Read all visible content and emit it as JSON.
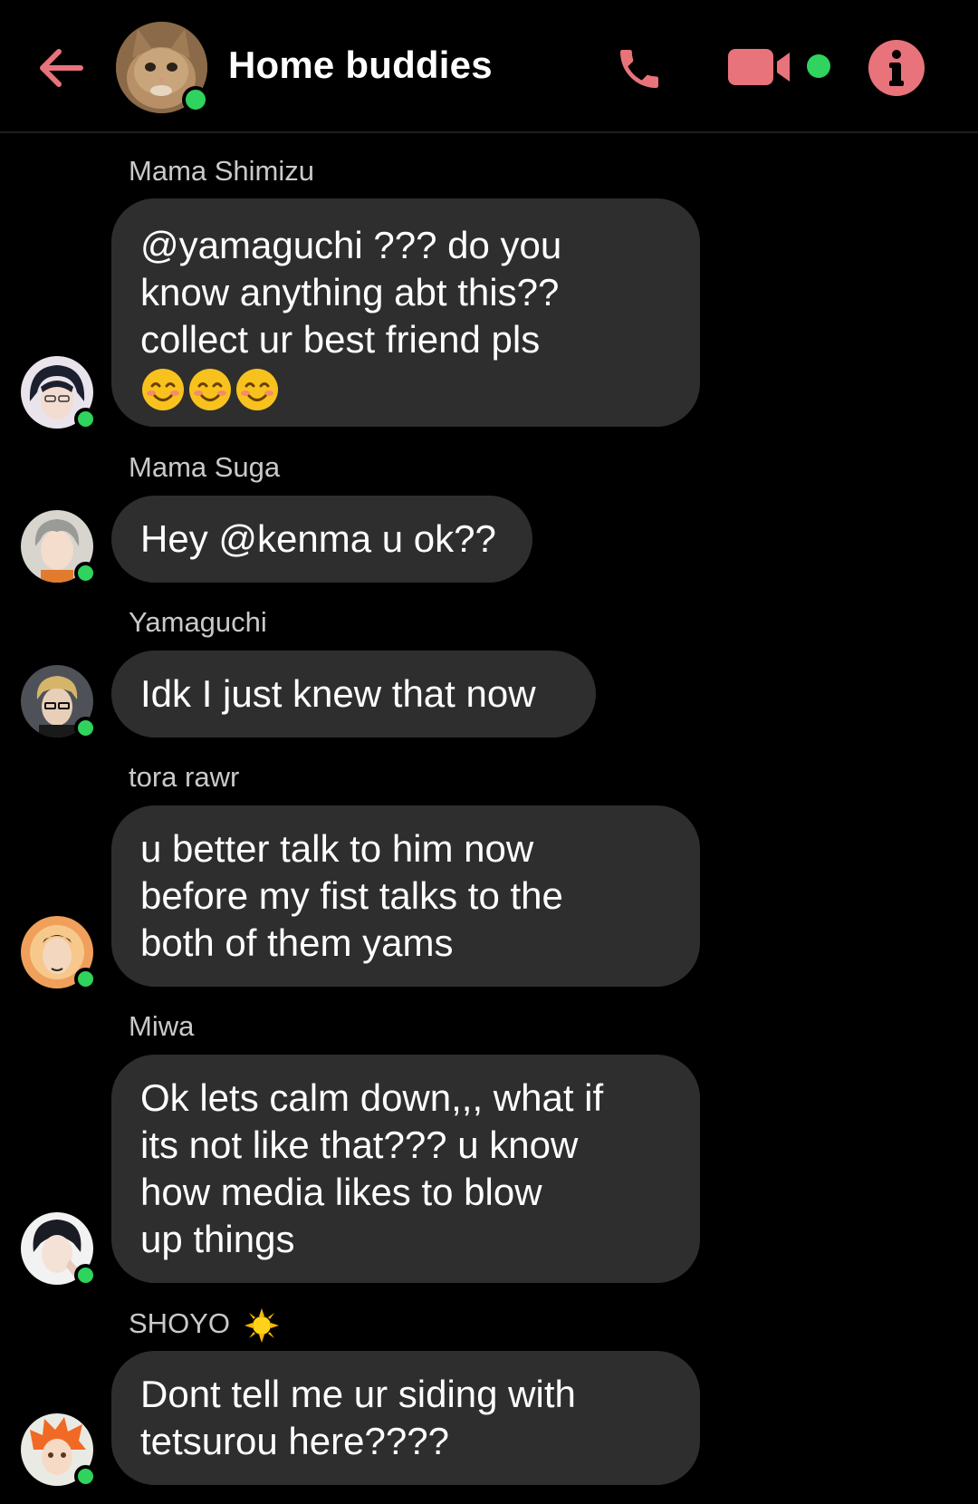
{
  "header": {
    "title": "Home buddies",
    "accent_color": "#e8737b",
    "online_color": "#2fd35d",
    "icons": [
      "back-arrow-icon",
      "phone-icon",
      "video-camera-icon",
      "info-icon"
    ]
  },
  "messages": [
    {
      "sender": "Mama Shimizu",
      "lines": [
        "@yamaguchi ??? do you",
        "know anything abt this??",
        "collect ur best friend pls"
      ],
      "emoji": [
        "😊",
        "😊",
        "😊"
      ]
    },
    {
      "sender": "Mama Suga",
      "lines": [
        "Hey @kenma u ok??"
      ]
    },
    {
      "sender": "Yamaguchi",
      "lines": [
        "Idk I just knew that now"
      ]
    },
    {
      "sender": "tora rawr",
      "lines": [
        "u better talk to him now",
        "before my fist talks to the",
        "both of them yams"
      ]
    },
    {
      "sender": "Miwa",
      "lines": [
        "Ok lets calm down,,, what if",
        "its not like that??? u know",
        "how media likes to blow",
        "up things"
      ]
    },
    {
      "sender": "SHOYO",
      "sender_emoji": "🌞",
      "lines": [
        "Dont tell me ur siding with",
        "tetsurou here????"
      ]
    }
  ]
}
